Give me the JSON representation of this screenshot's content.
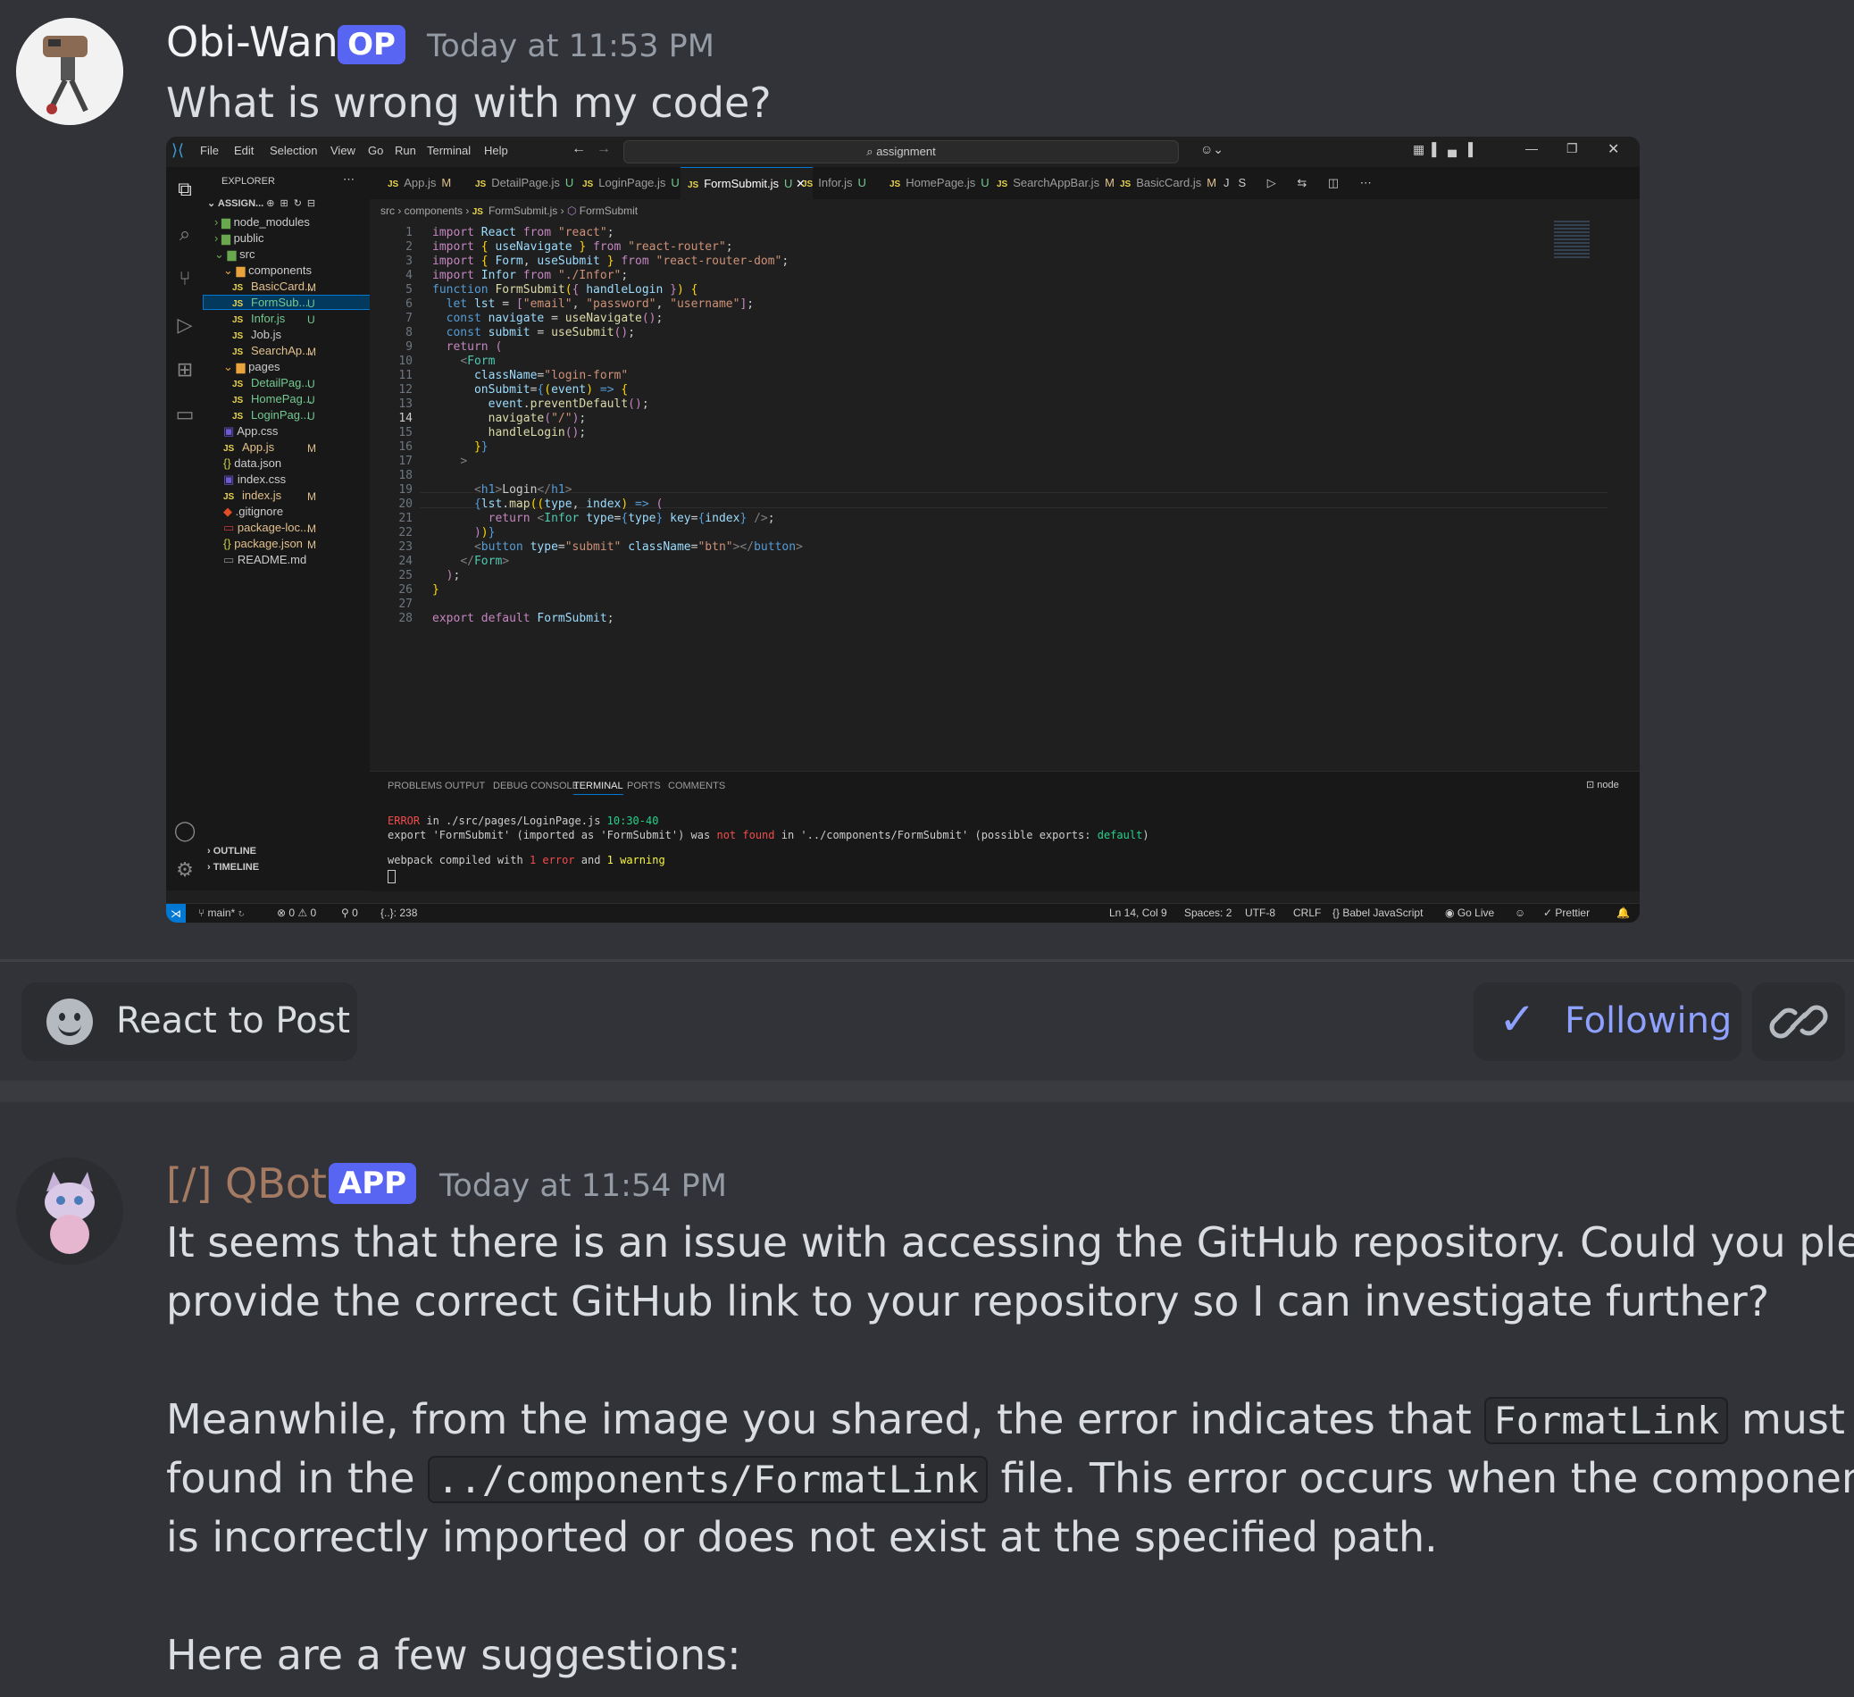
{
  "post": {
    "author": "Obi-Wan",
    "badge": "OP",
    "timestamp": "Today at 11:53 PM",
    "text": "What is wrong with my code?"
  },
  "vscode": {
    "menu": [
      "File",
      "Edit",
      "Selection",
      "View",
      "Go",
      "Run",
      "Terminal",
      "Help"
    ],
    "search": "assignment",
    "explorer_title": "EXPLORER",
    "root": "ASSIGN...",
    "tree": [
      {
        "label": "node_modules",
        "status": ""
      },
      {
        "label": "public",
        "status": ""
      },
      {
        "label": "src",
        "status": ""
      },
      {
        "label": "components",
        "status": ""
      },
      {
        "label": "BasicCard...",
        "status": "M"
      },
      {
        "label": "FormSub...",
        "status": "U"
      },
      {
        "label": "Infor.js",
        "status": "U"
      },
      {
        "label": "Job.js",
        "status": ""
      },
      {
        "label": "SearchAp...",
        "status": "M"
      },
      {
        "label": "pages",
        "status": ""
      },
      {
        "label": "DetailPag...",
        "status": "U"
      },
      {
        "label": "HomePag...",
        "status": "U"
      },
      {
        "label": "LoginPag...",
        "status": "U"
      },
      {
        "label": "App.css",
        "status": ""
      },
      {
        "label": "App.js",
        "status": "M"
      },
      {
        "label": "data.json",
        "status": ""
      },
      {
        "label": "index.css",
        "status": ""
      },
      {
        "label": "index.js",
        "status": "M"
      },
      {
        "label": ".gitignore",
        "status": ""
      },
      {
        "label": "package-loc...",
        "status": "M"
      },
      {
        "label": "package.json",
        "status": "M"
      },
      {
        "label": "README.md",
        "status": ""
      }
    ],
    "outline": "OUTLINE",
    "timeline": "TIMELINE",
    "tabs": [
      {
        "label": "App.js",
        "status": "M"
      },
      {
        "label": "DetailPage.js",
        "status": "U"
      },
      {
        "label": "LoginPage.js",
        "status": "U"
      },
      {
        "label": "FormSubmit.js",
        "status": "U"
      },
      {
        "label": "Infor.js",
        "status": "U"
      },
      {
        "label": "HomePage.js",
        "status": "U"
      },
      {
        "label": "SearchAppBar.js",
        "status": "M"
      },
      {
        "label": "BasicCard.js",
        "status": "M"
      }
    ],
    "breadcrumb": [
      "src",
      "components",
      "FormSubmit.js",
      "FormSubmit"
    ],
    "line_numbers": [
      "1",
      "2",
      "3",
      "4",
      "5",
      "6",
      "7",
      "8",
      "9",
      "10",
      "11",
      "12",
      "13",
      "14",
      "15",
      "16",
      "17",
      "18",
      "19",
      "20",
      "21",
      "22",
      "23",
      "24",
      "25",
      "26",
      "27",
      "28"
    ],
    "panel_tabs": [
      "PROBLEMS",
      "OUTPUT",
      "DEBUG CONSOLE",
      "TERMINAL",
      "PORTS",
      "COMMENTS"
    ],
    "terminal_shell": "node",
    "terminal": {
      "l1_error": "ERROR",
      "l1_in": " in ./src/pages/LoginPage.js ",
      "l1_pos": "10:30-40",
      "l2": "export 'FormSubmit' (imported as 'FormSubmit') was ",
      "l2_nf": "not found",
      "l2_b": " in '../components/FormSubmit' (possible exports: ",
      "l2_def": "default",
      "l2_c": ")",
      "l3_a": "webpack compiled with ",
      "l3_err": "1 error",
      "l3_b": " and ",
      "l3_warn": "1 warning"
    },
    "status": {
      "branch": "main*",
      "problems": "⊗ 0 ⚠ 0",
      "ports": "⚲ 0",
      "braces": "{..}: 238",
      "position": "Ln 14, Col 9",
      "spaces": "Spaces: 2",
      "encoding": "UTF-8",
      "eol": "CRLF",
      "language": "{} Babel JavaScript",
      "golive": "Go Live",
      "prettier": "✓ Prettier"
    }
  },
  "actions": {
    "react": "React to Post",
    "following": "Following"
  },
  "reply": {
    "author": "[/] QBot",
    "badge": "APP",
    "timestamp": "Today at 11:54 PM",
    "p1_l1": "It seems that there is an issue with accessing the GitHub repository. Could you please",
    "p1_l2": "provide the correct GitHub link to your repository so I can investigate further?",
    "p2_l1_a": "Meanwhile, from the image you shared, the error indicates that ",
    "p2_code1": "FormatLink",
    "p2_l1_b": " must be",
    "p2_l2_a": "found in the ",
    "p2_code2": "../components/FormatLink",
    "p2_l2_b": " file. This error occurs when the component",
    "p2_l3": "is incorrectly imported or does not exist at the specified path.",
    "p3": "Here are a few suggestions:"
  },
  "colors": {
    "background": "#323339",
    "badge_op": "#5865f2",
    "badge_app": "#5865f2",
    "following": "#8ea1ff",
    "qbot_name": "#a47a62"
  }
}
